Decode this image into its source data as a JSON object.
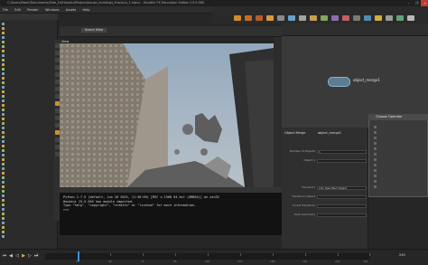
{
  "window": {
    "title": "C:/Users/Mark/Documents/Side_Fx/Houdini/Project/house_buildings_fracture_1.hipnc - Houdini FX Education Edition 15.5.565",
    "controls": [
      "–",
      "❐",
      "✕"
    ]
  },
  "menu": [
    "File",
    "Edit",
    "Render",
    "Windows",
    "Assets",
    "Help"
  ],
  "viewport": {
    "tab": "Scene View",
    "label": "View"
  },
  "console": {
    "lines": [
      "Python 2.7.5 (default, Jun 28 2015, 11:38:09) [MSC v.1500 64 bit (AMD64)] on win32",
      "Houdini 15.5.565 hou module imported.",
      "Type \"help\", \"copyright\", \"credits\" or \"license\" for more information.",
      ">>>"
    ]
  },
  "network": {
    "node_label": "object_merge1"
  },
  "parameters": {
    "header": "Object Merge",
    "node": "object_merge1",
    "rows": [
      {
        "label": "Number of Objects",
        "value": "1"
      },
      {
        "label": "Object 1",
        "value": ""
      },
      {
        "label": "Transform",
        "value": "Into Specified Object"
      },
      {
        "label": "Transform Object",
        "value": ""
      },
      {
        "label": "Invert Transform",
        "value": ""
      },
      {
        "label": "Pack Geometry",
        "value": ""
      }
    ]
  },
  "dialog": {
    "title": "Choose Operator"
  },
  "timeline": {
    "current_frame": "1",
    "end_frame": "240",
    "tick_labels": [
      "24",
      "48",
      "72",
      "96",
      "120",
      "144",
      "168",
      "192",
      "216",
      "240"
    ]
  }
}
